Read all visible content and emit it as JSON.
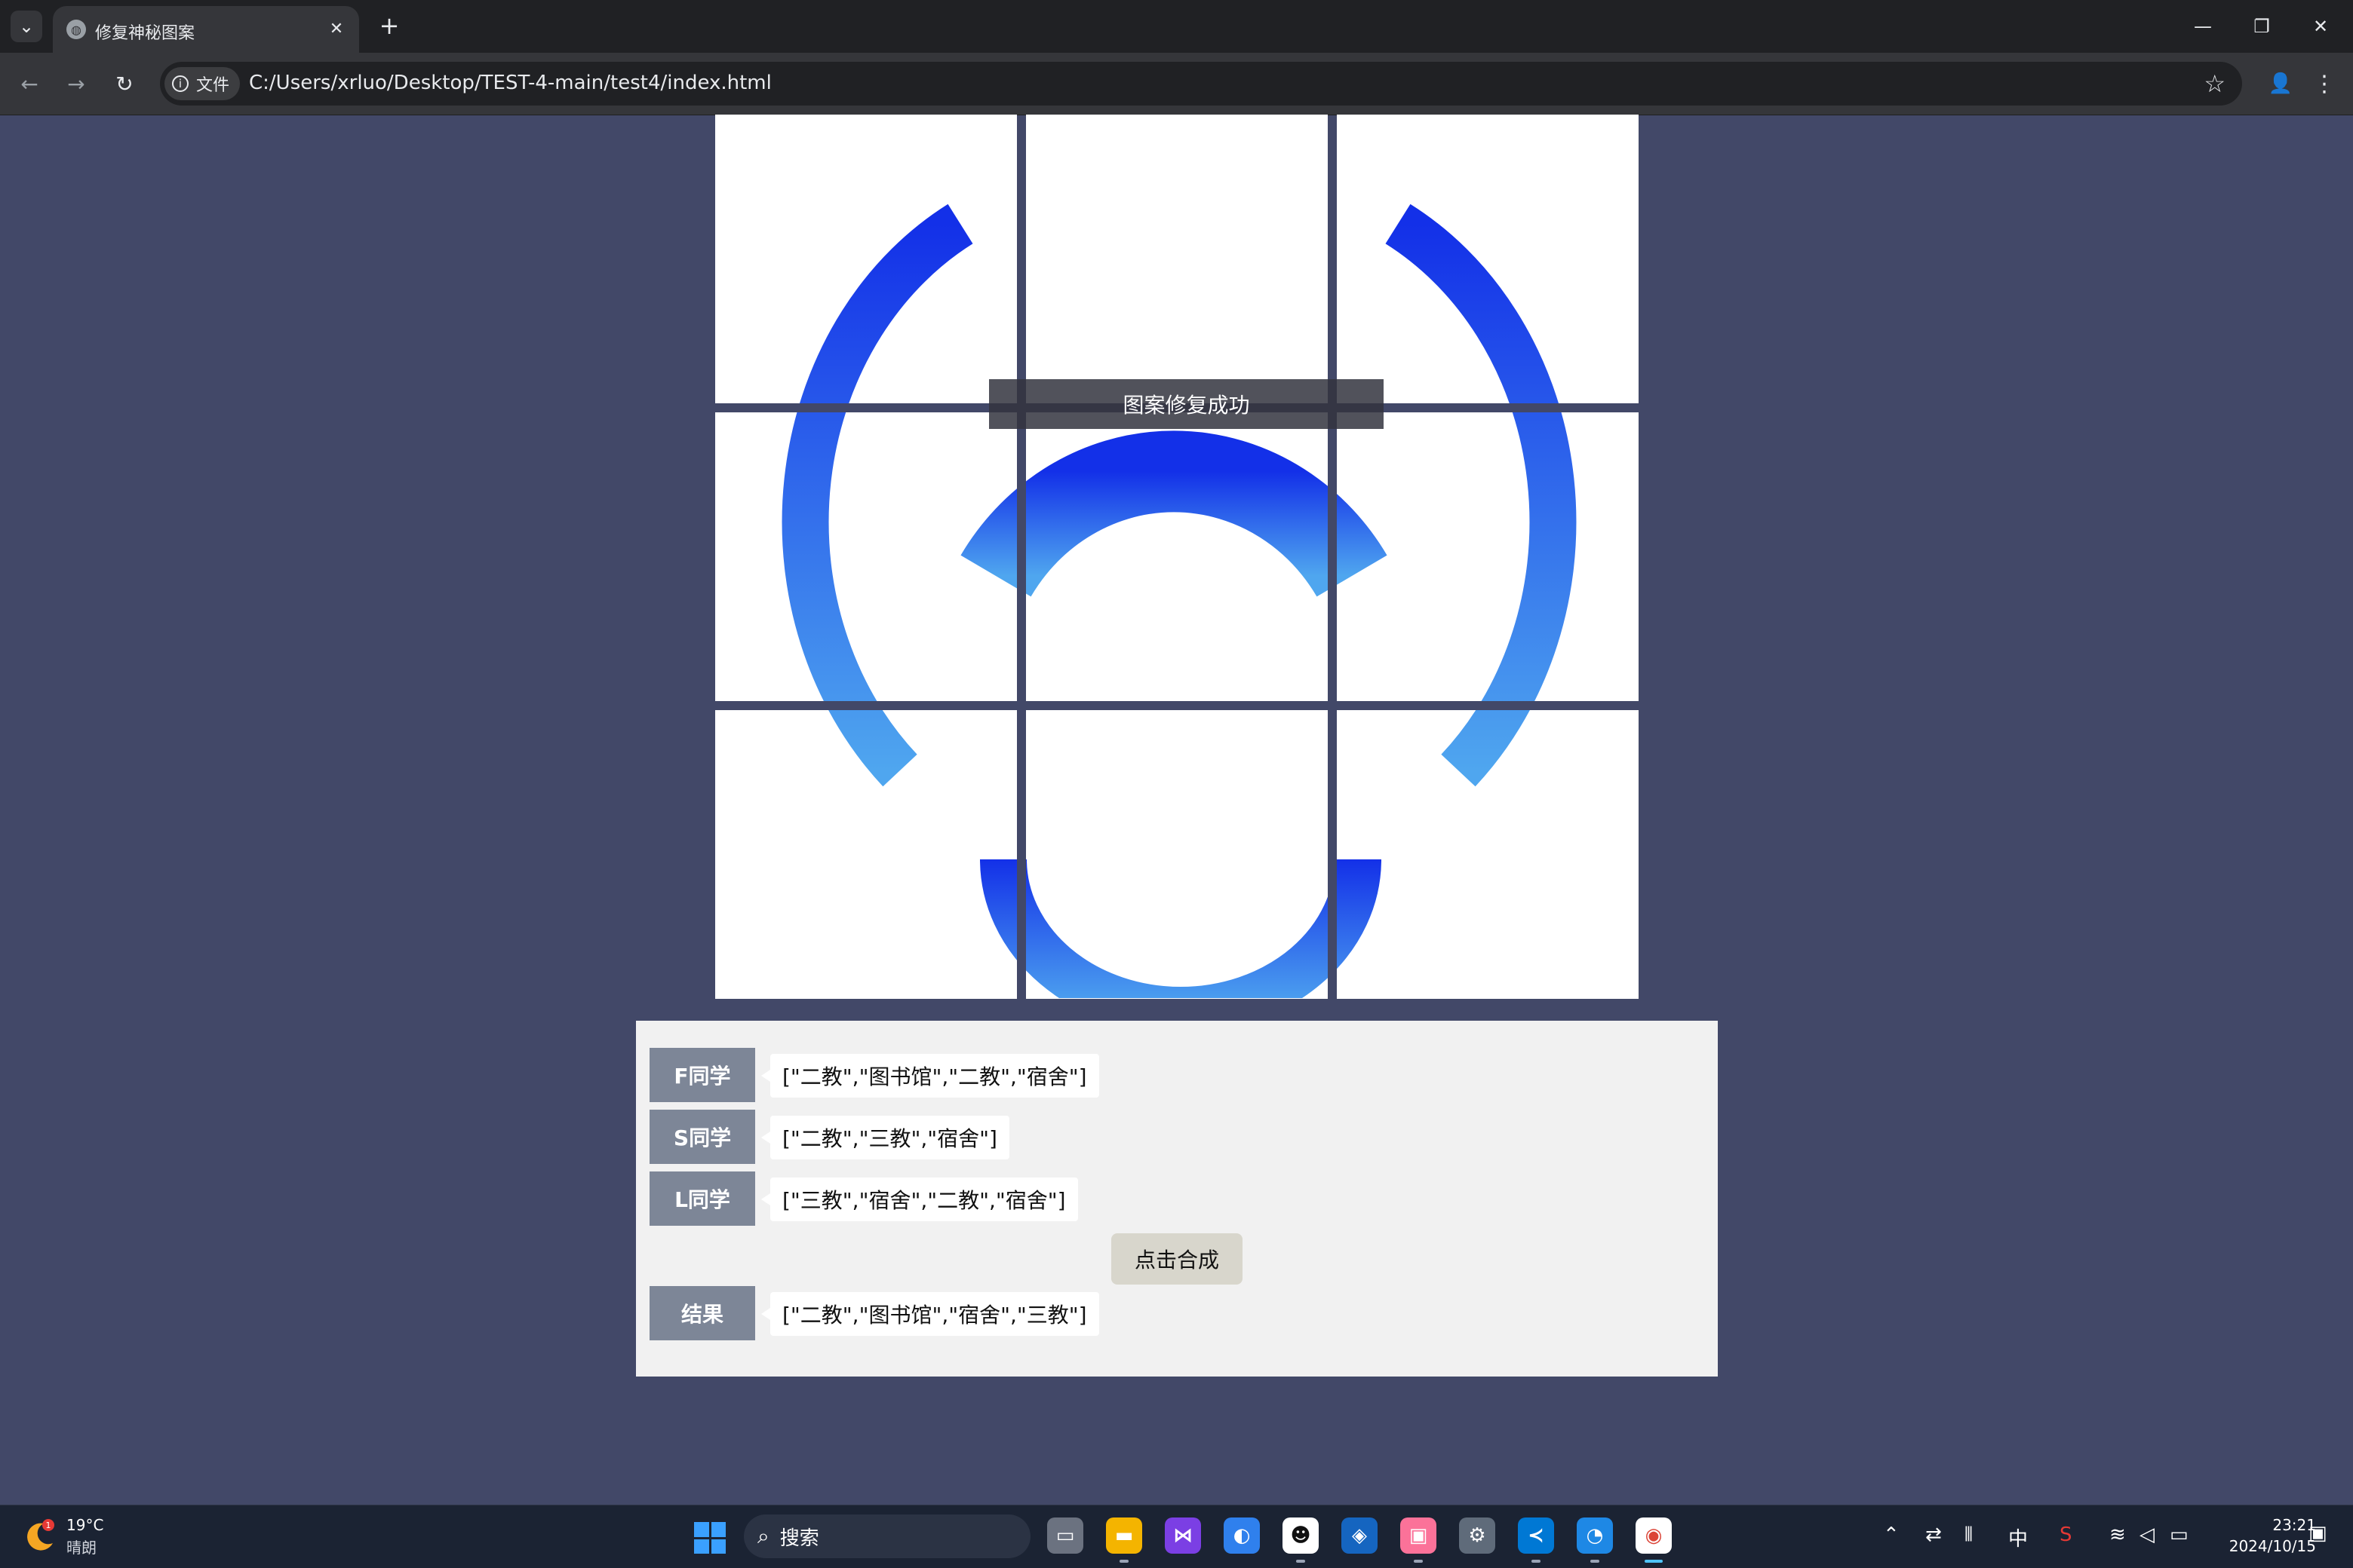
{
  "browser": {
    "tab_title": "修复神秘图案",
    "site_chip": "文件",
    "url": "C:/Users/xrluo/Desktop/TEST-4-main/test4/index.html",
    "new_tab": "+",
    "tab_close": "✕",
    "min": "—",
    "restore": "❐",
    "close": "✕",
    "back": "←",
    "forward": "→",
    "reload": "↻",
    "star": "☆",
    "profile": "👤",
    "menu": "⋮",
    "tab_menu": "⌄"
  },
  "puzzle": {
    "toast": "图案修复成功",
    "colors": {
      "logo_dark": "#1330e8",
      "logo_light": "#4fa6ef",
      "tile_bg": "#ffffff"
    }
  },
  "panel": {
    "rows": [
      {
        "label": "F同学",
        "value": "[\"二教\",\"图书馆\",\"二教\",\"宿舍\"]"
      },
      {
        "label": "S同学",
        "value": "[\"二教\",\"三教\",\"宿舍\"]"
      },
      {
        "label": "L同学",
        "value": "[\"三教\",\"宿舍\",\"二教\",\"宿舍\"]"
      }
    ],
    "merge_button": "点击合成",
    "result": {
      "label": "结果",
      "value": "[\"二教\",\"图书馆\",\"宿舍\",\"三教\"]"
    }
  },
  "taskbar": {
    "weather_temp": "19°C",
    "weather_desc": "晴朗",
    "weather_badge": "1",
    "search_placeholder": "搜索",
    "search_glyph": "⌕",
    "ime": "中",
    "time": "23:21",
    "date": "2024/10/15",
    "apps": [
      "task-view",
      "file-explorer",
      "visual-studio",
      "browser-blue",
      "qq",
      "app-blue",
      "bilibili",
      "settings",
      "vscode",
      "edge-like",
      "chrome"
    ]
  }
}
